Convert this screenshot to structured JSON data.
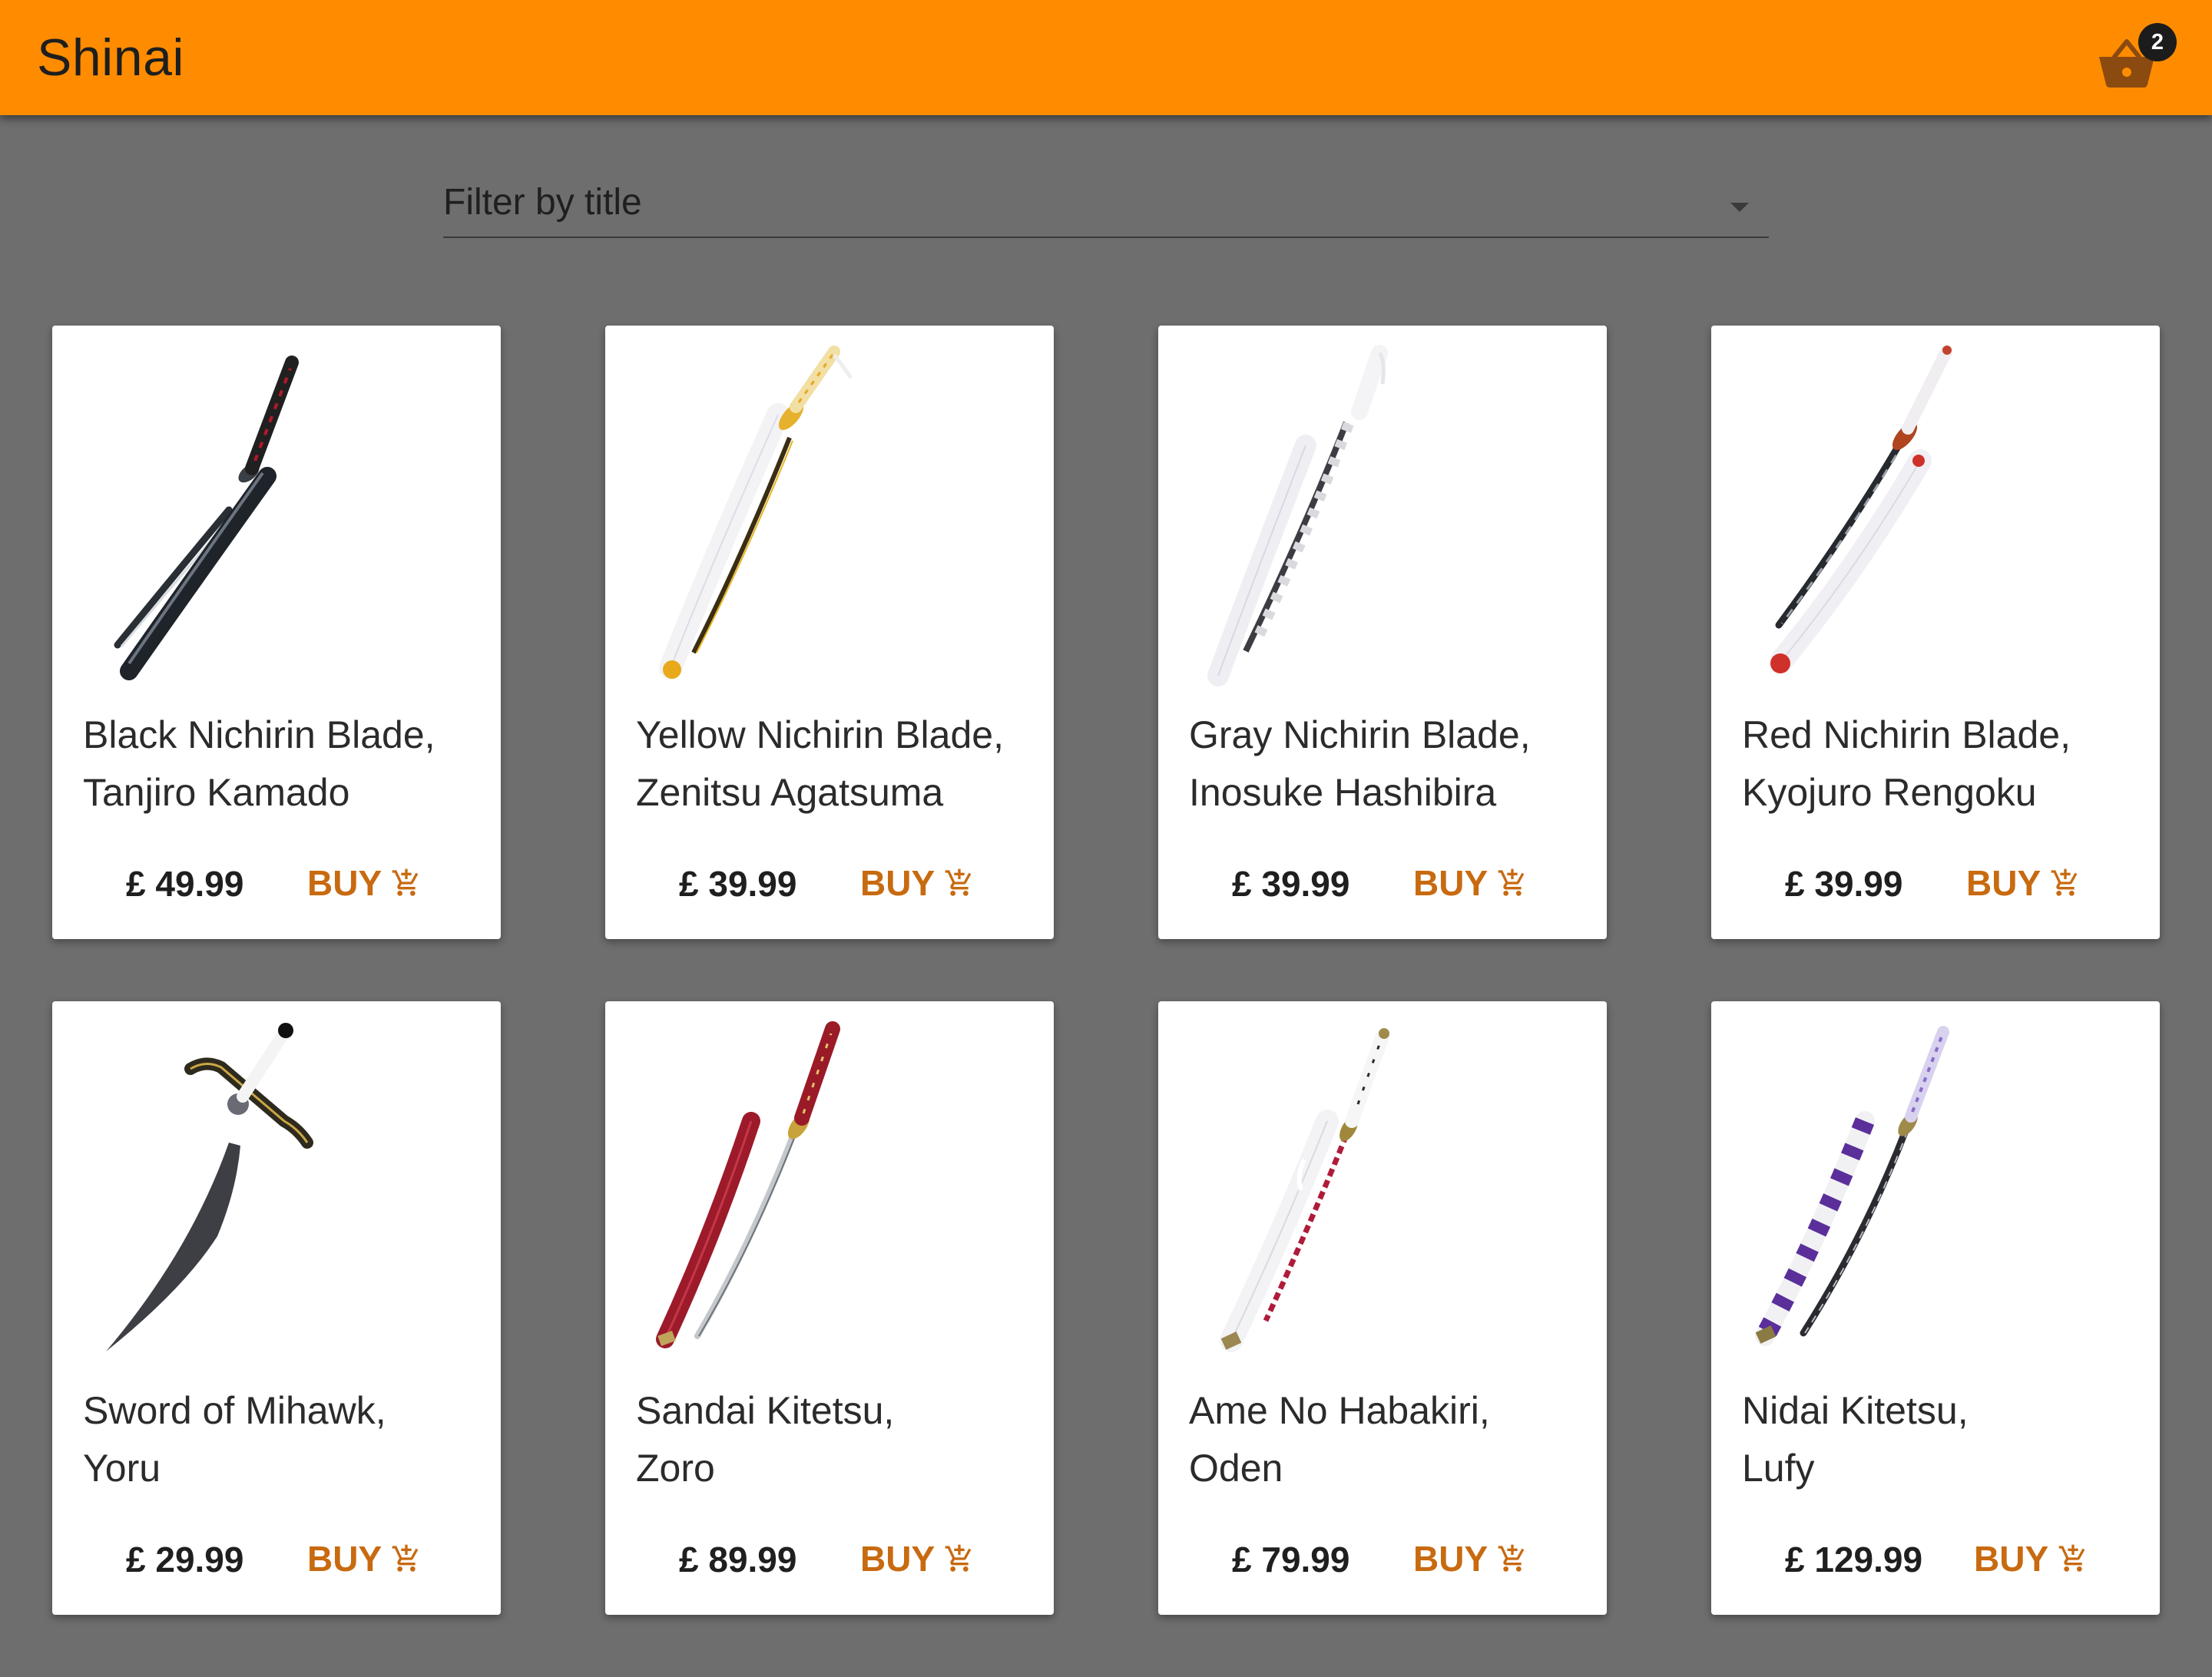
{
  "app": {
    "title": "Shinai"
  },
  "cart": {
    "count": "2",
    "icon": "basket-icon"
  },
  "filter": {
    "label": "Filter by title",
    "icon": "caret-down-icon"
  },
  "colors": {
    "appbar": "#ff8c00",
    "background": "#6e6e6e",
    "buy": "#c86a10"
  },
  "products": [
    {
      "title_line1": "Black Nichirin Blade,",
      "title_line2": "Tanjiro Kamado",
      "price": "£ 49.99",
      "buy_label": "BUY"
    },
    {
      "title_line1": "Yellow Nichirin Blade,",
      "title_line2": "Zenitsu Agatsuma",
      "price": "£ 39.99",
      "buy_label": "BUY"
    },
    {
      "title_line1": "Gray Nichirin Blade,",
      "title_line2": "Inosuke Hashibira",
      "price": "£ 39.99",
      "buy_label": "BUY"
    },
    {
      "title_line1": "Red Nichirin Blade,",
      "title_line2": "Kyojuro Rengoku",
      "price": "£ 39.99",
      "buy_label": "BUY"
    },
    {
      "title_line1": "Sword of Mihawk,",
      "title_line2": "Yoru",
      "price": "£ 29.99",
      "buy_label": "BUY"
    },
    {
      "title_line1": "Sandai Kitetsu,",
      "title_line2": "Zoro",
      "price": "£ 89.99",
      "buy_label": "BUY"
    },
    {
      "title_line1": "Ame No Habakiri,",
      "title_line2": "Oden",
      "price": "£ 79.99",
      "buy_label": "BUY"
    },
    {
      "title_line1": "Nidai Kitetsu,",
      "title_line2": "Lufy",
      "price": "£ 129.99",
      "buy_label": "BUY"
    }
  ]
}
